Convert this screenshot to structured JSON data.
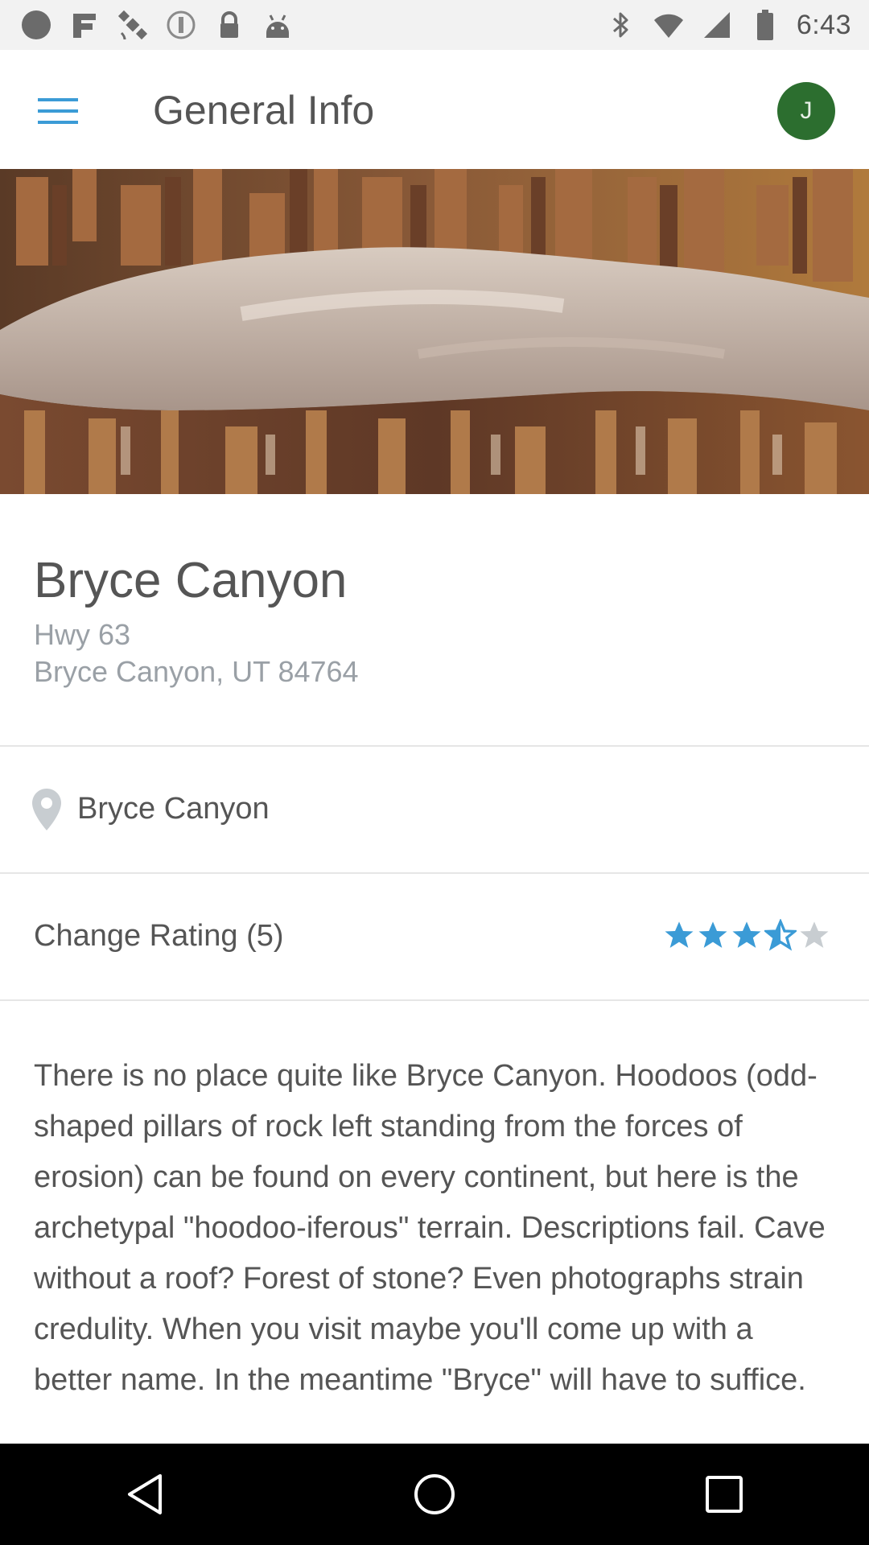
{
  "status_bar": {
    "time": "6:43",
    "icons": [
      "circle-icon",
      "fake-gps-icon",
      "satellite-icon",
      "radio-icon",
      "lock-icon",
      "android-icon",
      "bluetooth-icon"
    ]
  },
  "app_bar": {
    "title": "General Info",
    "avatar_initial": "J",
    "avatar_color": "#2c6e2f",
    "accent_color": "#3b9bd6"
  },
  "place": {
    "name": "Bryce Canyon",
    "address_line1": "Hwy 63",
    "address_line2": "Bryce Canyon, UT 84764",
    "location_label": "Bryce Canyon",
    "rating_label": "Change Rating (5)",
    "rating_value": 3.5,
    "rating_max": 5,
    "description": "There is no place quite like Bryce Canyon. Hoodoos (odd-shaped pillars of rock left standing from the forces of erosion) can be found on every continent, but here is the archetypal \"hoodoo-iferous\" terrain. Descriptions fail. Cave without a roof? Forest of stone? Even photographs strain credulity. When you visit maybe you'll come up with a better name. In the meantime \"Bryce\" will have to suffice."
  },
  "nav_bar": {
    "buttons": [
      "back-icon",
      "home-icon",
      "recents-icon"
    ]
  }
}
